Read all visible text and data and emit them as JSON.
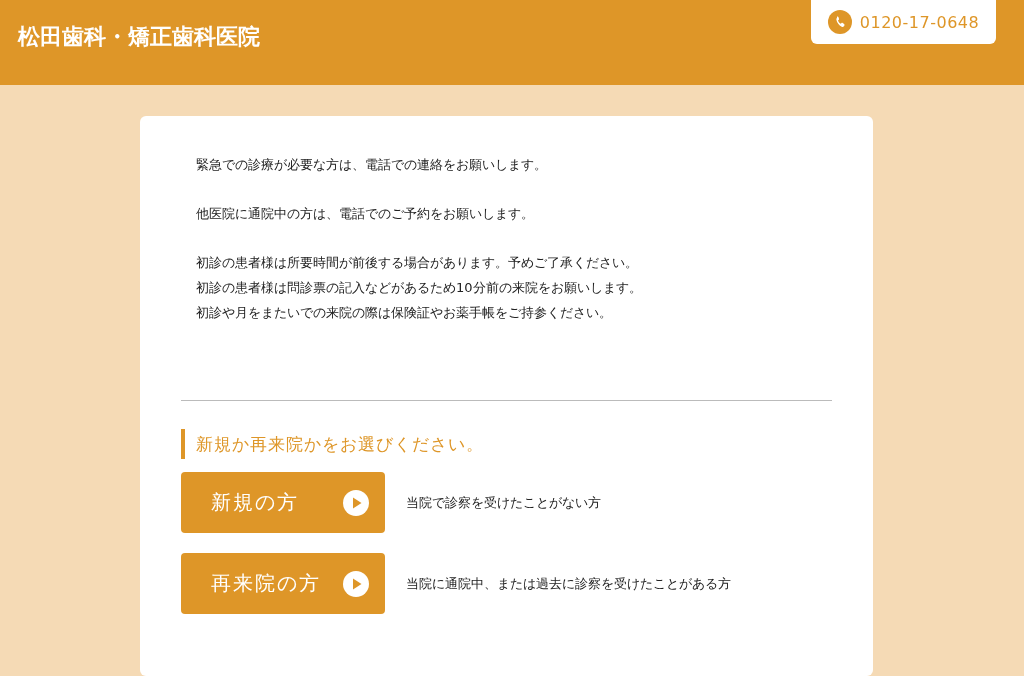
{
  "header": {
    "title": "松田歯科・矯正歯科医院",
    "phone": "0120-17-0648"
  },
  "notices": [
    [
      "緊急での診療が必要な方は、電話での連絡をお願いします。"
    ],
    [
      "他医院に通院中の方は、電話でのご予約をお願いします。"
    ],
    [
      "初診の患者様は所要時間が前後する場合があります。予めご了承ください。",
      "初診の患者様は問診票の記入などがあるため10分前の来院をお願いします。",
      "初診や月をまたいでの来院の際は保険証やお薬手帳をご持参ください。"
    ]
  ],
  "choice": {
    "heading": "新規か再来院かをお選びください。",
    "options": [
      {
        "label": "新規の方",
        "description": "当院で診察を受けたことがない方"
      },
      {
        "label": "再来院の方",
        "description": "当院に通院中、または過去に診察を受けたことがある方"
      }
    ]
  }
}
